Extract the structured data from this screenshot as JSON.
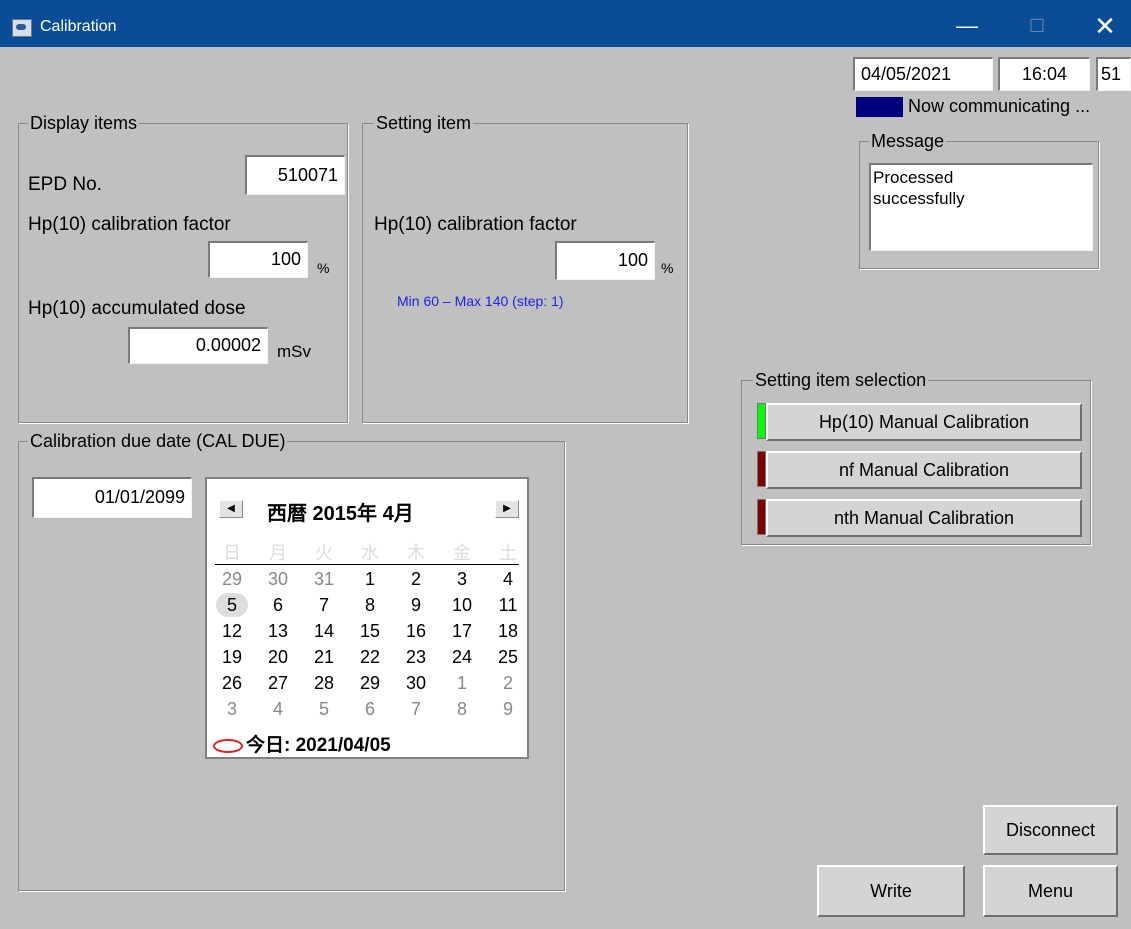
{
  "window": {
    "title": "Calibration",
    "minimize": "—",
    "maximize": "☐",
    "close": "✕"
  },
  "status": {
    "date": "04/05/2021",
    "time": "16:04",
    "extra": "51",
    "comm_text": "Now communicating ...",
    "comm_color": "#00007f"
  },
  "message": {
    "legend": "Message",
    "text": "Processed\nsuccessfully"
  },
  "display_items": {
    "legend": "Display items",
    "epd_label": "EPD No.",
    "epd_value": "510071",
    "cal_factor_label": "Hp(10) calibration factor",
    "cal_factor_value": "100",
    "cal_factor_unit": "%",
    "dose_label": "Hp(10) accumulated dose",
    "dose_value": "0.00002",
    "dose_unit": "mSv"
  },
  "setting_item": {
    "legend": "Setting item",
    "cal_factor_label": "Hp(10) calibration factor",
    "cal_factor_value": "100",
    "cal_factor_unit": "%",
    "range_hint": "Min 60 – Max 140 (step: 1)"
  },
  "selection": {
    "legend": "Setting item selection",
    "buttons": [
      {
        "label": "Hp(10) Manual Calibration",
        "indicator": "#00ff00"
      },
      {
        "label": "nf Manual Calibration",
        "indicator": "#7f0000"
      },
      {
        "label": "nth Manual Calibration",
        "indicator": "#7f0000"
      }
    ]
  },
  "cal_due": {
    "legend": "Calibration due date (CAL DUE)",
    "value": "01/01/2099",
    "calendar": {
      "title": "西暦 2015年 4月",
      "prev": "◀",
      "next": "▶",
      "weekdays": [
        "日",
        "月",
        "火",
        "水",
        "木",
        "金",
        "土"
      ],
      "weeks": [
        [
          "29",
          "30",
          "31",
          "1",
          "2",
          "3",
          "4"
        ],
        [
          "5",
          "6",
          "7",
          "8",
          "9",
          "10",
          "11"
        ],
        [
          "12",
          "13",
          "14",
          "15",
          "16",
          "17",
          "18"
        ],
        [
          "19",
          "20",
          "21",
          "22",
          "23",
          "24",
          "25"
        ],
        [
          "26",
          "27",
          "28",
          "29",
          "30",
          "1",
          "2"
        ],
        [
          "3",
          "4",
          "5",
          "6",
          "7",
          "8",
          "9"
        ]
      ],
      "today_label": "今日: 2021/04/05"
    }
  },
  "buttons": {
    "disconnect": "Disconnect",
    "write": "Write",
    "menu": "Menu"
  }
}
